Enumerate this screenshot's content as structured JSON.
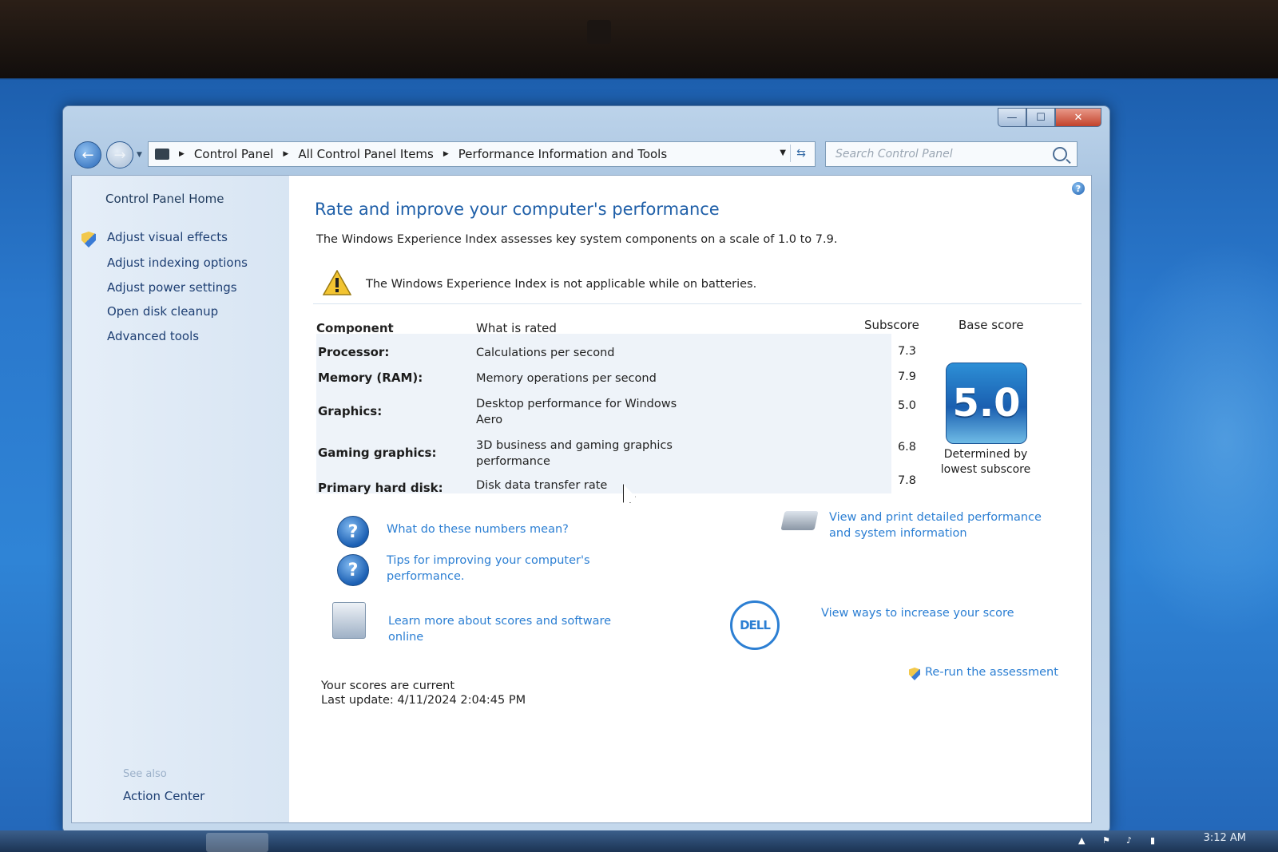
{
  "window": {
    "addressbar": {
      "crumbs": [
        "Control Panel",
        "All Control Panel Items",
        "Performance Information and Tools"
      ]
    },
    "search": {
      "placeholder": "Search Control Panel"
    }
  },
  "sidebar": {
    "home": "Control Panel Home",
    "items": [
      {
        "label": "Adjust visual effects",
        "icon": "shield-icon"
      },
      {
        "label": "Adjust indexing options"
      },
      {
        "label": "Adjust power settings"
      },
      {
        "label": "Open disk cleanup"
      },
      {
        "label": "Advanced tools"
      }
    ],
    "see_also_title": "See also",
    "see_also": [
      "Action Center"
    ]
  },
  "main": {
    "title": "Rate and improve your computer's performance",
    "intro": "The Windows Experience Index assesses key system components on a scale of 1.0 to 7.9.",
    "warning": "The Windows Experience Index is not applicable while on batteries.",
    "table": {
      "headers": {
        "component": "Component",
        "what": "What is rated",
        "subscore": "Subscore",
        "base": "Base score"
      },
      "rows": [
        {
          "component": "Processor:",
          "what": "Calculations per second",
          "subscore": "7.3"
        },
        {
          "component": "Memory (RAM):",
          "what": "Memory operations per second",
          "subscore": "7.9"
        },
        {
          "component": "Graphics:",
          "what": "Desktop performance for Windows Aero",
          "subscore": "5.0"
        },
        {
          "component": "Gaming graphics:",
          "what": "3D business and gaming graphics performance",
          "subscore": "6.8"
        },
        {
          "component": "Primary hard disk:",
          "what": "Disk data transfer rate",
          "subscore": "7.8"
        }
      ],
      "base_score": "5.0",
      "base_caption": "Determined by lowest subscore"
    },
    "links": {
      "numbers": "What do these numbers mean?",
      "tips": "Tips for improving your computer's performance.",
      "learn": "Learn more about scores and software online",
      "print": "View and print detailed performance and system information",
      "increase": "View ways to increase your score",
      "rerun": "Re-run the assessment"
    },
    "dell_logo": "DELL",
    "status": {
      "current": "Your scores are current",
      "last_update": "Last update: 4/11/2024 2:04:45 PM"
    }
  },
  "taskbar": {
    "clock": "3:12 AM"
  },
  "colors": {
    "accent": "#1f5fa8",
    "link": "#2c7fd3",
    "sidebar_link": "#1e3f73"
  }
}
